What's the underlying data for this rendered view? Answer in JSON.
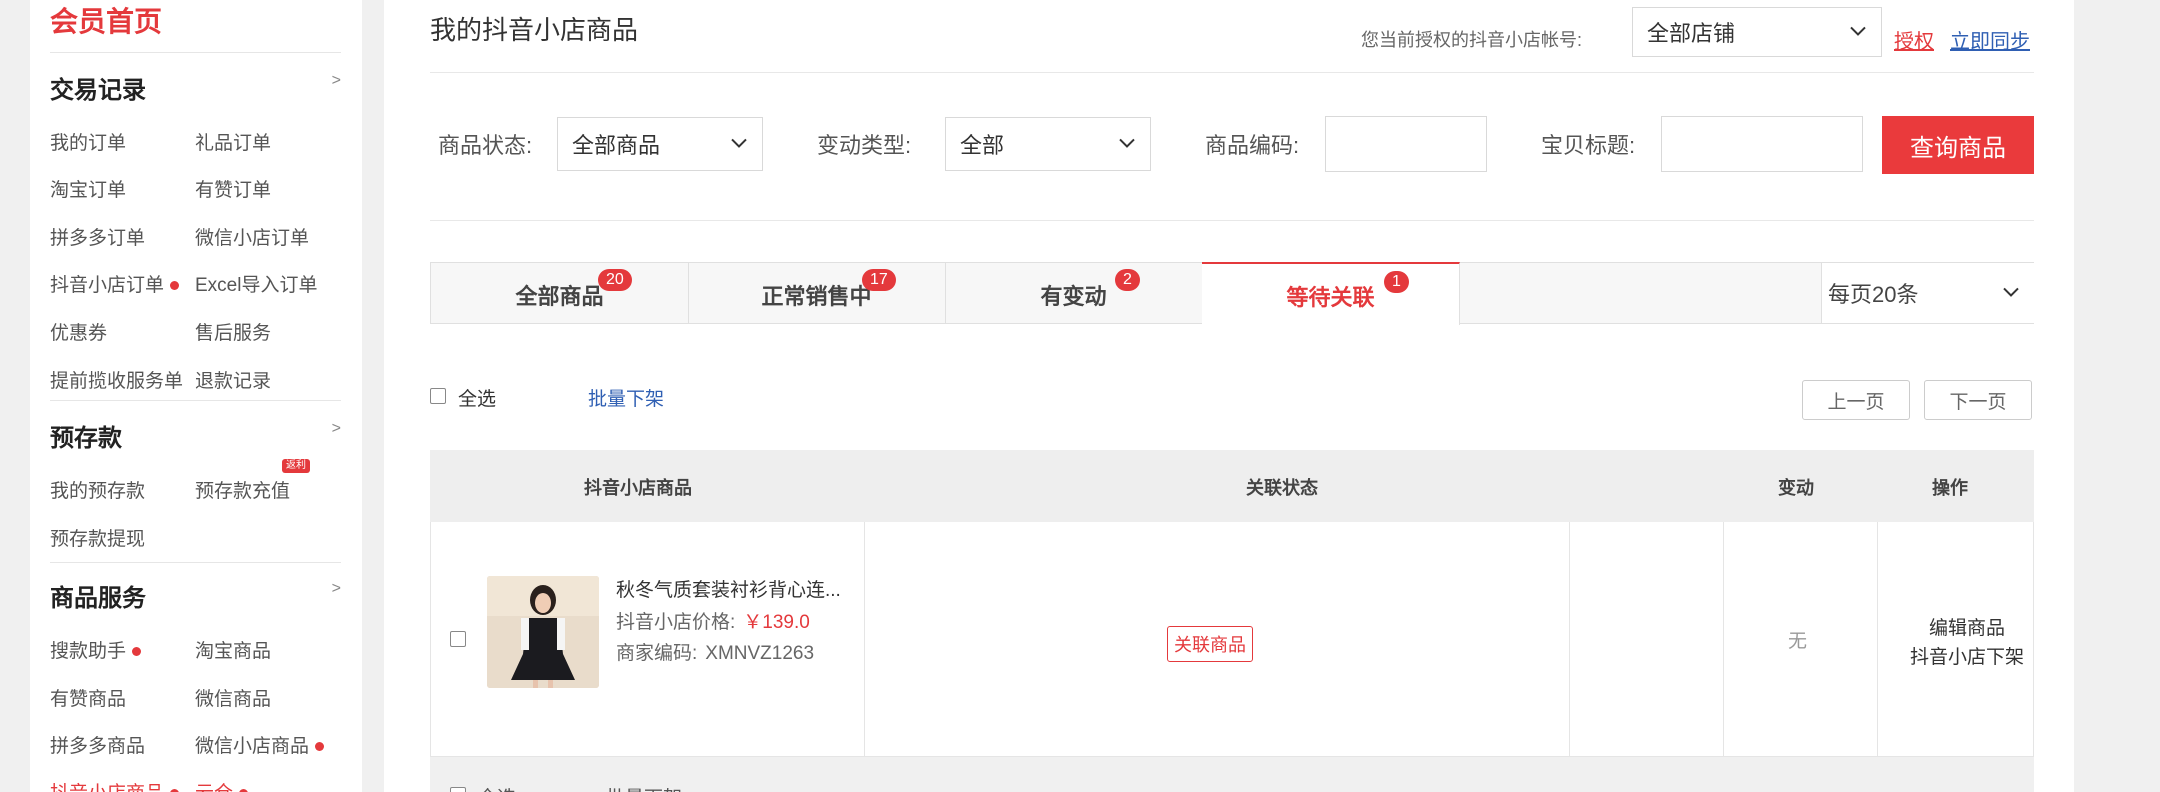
{
  "sidebar": {
    "home": "会员首页",
    "sections": [
      {
        "title": "交易记录",
        "arrow": ">",
        "items": [
          {
            "label": "我的订单",
            "dot": false
          },
          {
            "label": "礼品订单",
            "dot": false
          },
          {
            "label": "淘宝订单",
            "dot": false
          },
          {
            "label": "有赞订单",
            "dot": false
          },
          {
            "label": "拼多多订单",
            "dot": false
          },
          {
            "label": "微信小店订单",
            "dot": false
          },
          {
            "label": "抖音小店订单",
            "dot": true
          },
          {
            "label": "Excel导入订单",
            "dot": false
          },
          {
            "label": "优惠券",
            "dot": false
          },
          {
            "label": "售后服务",
            "dot": false
          },
          {
            "label": "提前揽收服务单",
            "dot": false
          },
          {
            "label": "退款记录",
            "dot": false
          }
        ]
      },
      {
        "title": "预存款",
        "arrow": ">",
        "items": [
          {
            "label": "我的预存款",
            "dot": false
          },
          {
            "label": "预存款充值",
            "dot": false,
            "badge": "返利"
          },
          {
            "label": "预存款提现",
            "dot": false
          }
        ]
      },
      {
        "title": "商品服务",
        "arrow": ">",
        "items": [
          {
            "label": "搜款助手",
            "dot": true
          },
          {
            "label": "淘宝商品",
            "dot": false
          },
          {
            "label": "有赞商品",
            "dot": false
          },
          {
            "label": "微信商品",
            "dot": false
          },
          {
            "label": "拼多多商品",
            "dot": false
          },
          {
            "label": "微信小店商品",
            "dot": true
          },
          {
            "label": "抖音小店商品",
            "dot": true,
            "active": true
          },
          {
            "label": "云仓",
            "dot": true
          }
        ]
      }
    ]
  },
  "header": {
    "title": "我的抖音小店商品",
    "account_label": "您当前授权的抖音小店帐号:",
    "account_value": "全部店铺",
    "authorize_link": "授权",
    "sync_link": "立即同步"
  },
  "filters": {
    "status_label": "商品状态:",
    "status_value": "全部商品",
    "change_label": "变动类型:",
    "change_value": "全部",
    "code_label": "商品编码:",
    "code_value": "",
    "title_label": "宝贝标题:",
    "title_value": "",
    "query_button": "查询商品"
  },
  "tabs": [
    {
      "label": "全部商品",
      "count": "20",
      "active": false
    },
    {
      "label": "正常销售中",
      "count": "17",
      "active": false
    },
    {
      "label": "有变动",
      "count": "2",
      "active": false
    },
    {
      "label": "等待关联",
      "count": "1",
      "active": true
    }
  ],
  "page_size": "每页20条",
  "bulk": {
    "select_all": "全选",
    "batch_offline": "批量下架",
    "prev_page": "上一页",
    "next_page": "下一页"
  },
  "table": {
    "columns": [
      "抖音小店商品",
      "关联状态",
      "变动",
      "操作"
    ],
    "rows": [
      {
        "name": "秋冬气质套装衬衫背心连...",
        "price_label": "抖音小店价格:",
        "price": "￥139.0",
        "code_label": "商家编码:",
        "code": "XMNVZ1263",
        "link_button": "关联商品",
        "change": "无",
        "edit": "编辑商品",
        "offline": "抖音小店下架"
      }
    ]
  },
  "footer_row": {
    "select_all": "全选",
    "batch_offline": "批量下架"
  },
  "colors": {
    "accent": "#e4393c",
    "link_blue": "#2f5fb3"
  }
}
